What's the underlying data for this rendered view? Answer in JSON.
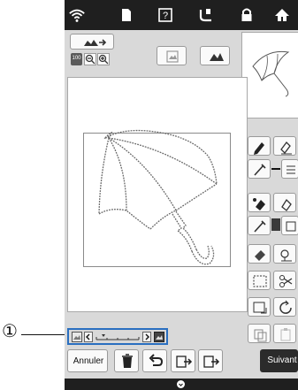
{
  "callout": {
    "number": "①"
  },
  "bottom_bar": {
    "cancel_label": "Annuler",
    "next_label": "Suivant"
  },
  "toolbar": {
    "zoom_level_label": "100"
  },
  "icons": {
    "statusbar": [
      "wifi-icon",
      "document-icon",
      "help-icon",
      "embroidery-icon",
      "lock-icon",
      "home-icon"
    ],
    "scroll": [
      "image-left-icon",
      "arrow-left-icon",
      "arrow-right-icon",
      "image-right-icon"
    ]
  },
  "colors": {
    "callout_outline": "#2a6fc0",
    "next_button": "#2b2b2b",
    "screen_bg": "#d9d9d9"
  }
}
